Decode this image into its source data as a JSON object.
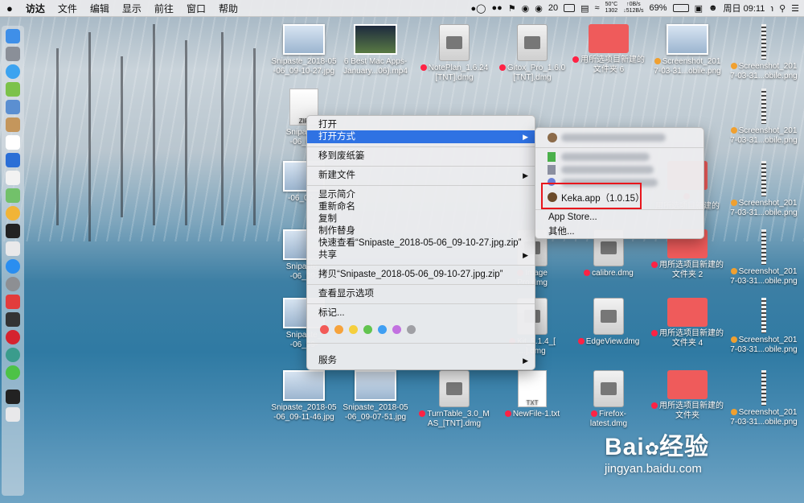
{
  "menubar": {
    "items": [
      "访达",
      "文件",
      "编辑",
      "显示",
      "前往",
      "窗口",
      "帮助"
    ],
    "status": {
      "badge": "20",
      "temp": "50°C",
      "fan": "1302",
      "net_up": "↑0B/s",
      "net_down": "↓512B/s",
      "battery": "69%",
      "clock": "周日 09:11"
    }
  },
  "desktop": {
    "files": [
      {
        "label": "Snipaste_2018-05-06_09-10-27.jpg",
        "line1": "Snipaste_2018-05",
        "line2": "-06_09-10-27.jpg",
        "kind": "img"
      },
      {
        "label": "6 Best Mac Apps-January...06).mp4",
        "line1": "6 Best Mac Apps-",
        "line2": "January...06).mp4",
        "kind": "video"
      },
      {
        "label": "NotePlan_1.6.24[TNT].dmg",
        "line1": "NotePlan_1.6.24",
        "line2": "[TNT].dmg",
        "kind": "dmg",
        "tag": "red"
      },
      {
        "label": "Gitox_Pro_1.6.0[TNT].dmg",
        "line1": "Gitox_Pro_1.6.0",
        "line2": "[TNT].dmg",
        "kind": "dmg",
        "tag": "red"
      },
      {
        "label": "用所选项目新建的文件夹 6",
        "line1": "用所选项目新建的",
        "line2": "文件夹 6",
        "kind": "folder",
        "tag": "red"
      },
      {
        "label": "Screenshot_2017-03-31...obile.png",
        "line1": "Screenshot_201",
        "line2": "7-03-31...obile.png",
        "kind": "img",
        "tag": "orange"
      },
      {
        "label": "Screenshot_2017-03-31...obile.png",
        "line1": "Screenshot_201",
        "line2": "7-03-31...obile.png",
        "kind": "strip",
        "tag": "orange"
      },
      {
        "label": "Snipaste_2018-05-06_09-10-27.jpg.zip",
        "line1": "Snipaste_",
        "line2": "-06_09-",
        "kind": "zip"
      },
      {
        "label": "Screenshot_2017-03-31...obile.png",
        "line1": "Screenshot_201",
        "line2": "7-03-31...obile.png",
        "kind": "strip",
        "tag": "orange"
      },
      {
        "label": "-06_09-1",
        "line1": "",
        "line2": "-06_09-1",
        "kind": "img"
      },
      {
        "label": "用所选项目新建的",
        "line1": "",
        "line2": "用所选项目新建的",
        "kind": "folder",
        "tag": "red"
      },
      {
        "label": "Screenshot_2017-03-31...obile.png",
        "line1": "Screenshot_201",
        "line2": "7-03-31...obile.png",
        "kind": "strip",
        "tag": "orange"
      },
      {
        "label": "Snipaste_2018-05-06_09-",
        "line1": "Snipaste_",
        "line2": "-06_09-",
        "kind": "img"
      },
      {
        "label": "Image Pro.dmg",
        "line1": "Image",
        "line2": "Pro.dmg",
        "kind": "dmg",
        "tag": "red"
      },
      {
        "label": "calibre.dmg",
        "line1": "calibre.dmg",
        "line2": "",
        "kind": "dmg",
        "tag": "red"
      },
      {
        "label": "用所选项目新建的文件夹 2",
        "line1": "用所选项目新建的",
        "line2": "文件夹 2",
        "kind": "folder",
        "tag": "red"
      },
      {
        "label": "Screenshot_2017-03-31...obile.png",
        "line1": "Screenshot_201",
        "line2": "7-03-31...obile.png",
        "kind": "strip",
        "tag": "orange"
      },
      {
        "label": "Snipaste_2018-05-06_09-",
        "line1": "Snipaste_",
        "line2": "-06_09-",
        "kind": "img"
      },
      {
        "label": "Kit_9.1.4_[...].dmg",
        "line1": "Kit_9.1.4_[",
        "line2": "...].dmg",
        "kind": "dmg",
        "tag": "red"
      },
      {
        "label": "EdgeView.dmg",
        "line1": "EdgeView.dmg",
        "line2": "",
        "kind": "dmg",
        "tag": "red"
      },
      {
        "label": "用所选项目新建的文件夹 4",
        "line1": "用所选项目新建的",
        "line2": "文件夹 4",
        "kind": "folder",
        "tag": "red"
      },
      {
        "label": "Screenshot_2017-03-31...obile.png",
        "line1": "Screenshot_201",
        "line2": "7-03-31...obile.png",
        "kind": "strip",
        "tag": "orange"
      },
      {
        "label": "Snipaste_2018-05-06_09-11-46.jpg",
        "line1": "Snipaste_2018-05",
        "line2": "-06_09-11-46.jpg",
        "kind": "img"
      },
      {
        "label": "Snipaste_2018-05-06_09-07-51.jpg",
        "line1": "Snipaste_2018-05",
        "line2": "-06_09-07-51.jpg",
        "kind": "img"
      },
      {
        "label": "TurnTable_3.0_MAS_[TNT].dmg",
        "line1": "TurnTable_3.0_M",
        "line2": "AS_[TNT].dmg",
        "kind": "dmg",
        "tag": "red"
      },
      {
        "label": "NewFile-1.txt",
        "line1": "NewFile-1.txt",
        "line2": "",
        "kind": "txt",
        "tag": "red"
      },
      {
        "label": "Firefox-latest.dmg",
        "line1": "Firefox-",
        "line2": "latest.dmg",
        "kind": "dmg",
        "tag": "red"
      },
      {
        "label": "用所选项目新建的文件夹",
        "line1": "用所选项目新建的",
        "line2": "文件夹",
        "kind": "folder",
        "tag": "red"
      },
      {
        "label": "Screenshot_2017-03-31...obile.png",
        "line1": "Screenshot_201",
        "line2": "7-03-31...obile.png",
        "kind": "strip",
        "tag": "orange"
      }
    ],
    "txt_icon_text": "TXT",
    "zip_icon_text": "ZIP",
    "folder_partial": "rx"
  },
  "context_menu": {
    "items": [
      {
        "label": "打开"
      },
      {
        "label": "打开方式",
        "submenu": true,
        "selected": true
      },
      {
        "label": "移到废纸篓"
      },
      {
        "label": "新建文件",
        "submenu": true
      },
      {
        "label": "显示简介"
      },
      {
        "label": "重新命名"
      },
      {
        "label": "复制"
      },
      {
        "label": "制作替身"
      },
      {
        "label": "快速查看“Snipaste_2018-05-06_09-10-27.jpg.zip”"
      },
      {
        "label": "共享",
        "submenu": true
      },
      {
        "label": "拷贝“Snipaste_2018-05-06_09-10-27.jpg.zip”"
      },
      {
        "label": "查看显示选项"
      },
      {
        "label": "标记..."
      },
      {
        "label": "服务",
        "submenu": true
      }
    ],
    "tag_colors": [
      "#f25a57",
      "#f6a33c",
      "#f5cf3d",
      "#62c44f",
      "#3f9ff3",
      "#c271e0",
      "#a0a0a5"
    ]
  },
  "open_with_submenu": {
    "highlighted_app": "Keka.app（1.0.15）",
    "app_store": "App Store...",
    "other": "其他..."
  },
  "watermark": {
    "brand": "Bai",
    "brand_tail": "经验",
    "url": "jingyan.baidu.com"
  },
  "colors": {
    "selection": "#2f72e3",
    "highlight_box": "#e8161d"
  }
}
